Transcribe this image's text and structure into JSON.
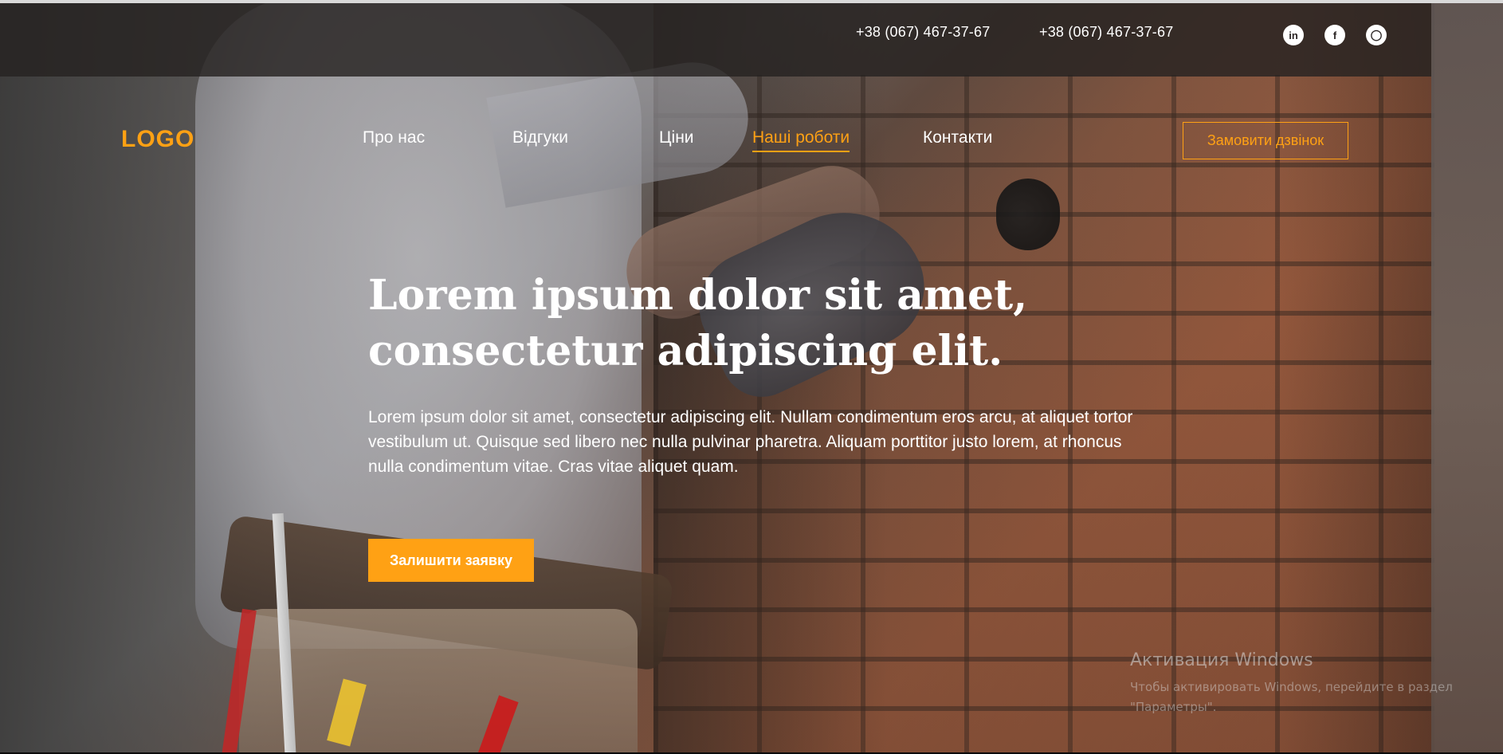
{
  "header": {
    "phones": [
      "+38 (067) 467-37-67",
      "+38 (067) 467-37-67"
    ],
    "social_icons": [
      {
        "name": "linkedin-icon",
        "glyph": "in"
      },
      {
        "name": "facebook-icon",
        "glyph": "f"
      },
      {
        "name": "instagram-icon",
        "glyph": "◯"
      }
    ]
  },
  "nav": {
    "logo": "LOGO",
    "items": [
      "Про нас",
      "Відгуки",
      "Ціни",
      "Наші роботи",
      "Контакти"
    ],
    "active_item": "Наші роботи",
    "call_button": "Замовити дзвінок"
  },
  "hero": {
    "title": "Lorem ipsum dolor sit amet, consectetur adipiscing elit.",
    "text": "Lorem ipsum dolor sit amet, consectetur adipiscing elit. Nullam condimentum eros arcu, at aliquet tortor vestibulum ut. Quisque sed libero nec nulla pulvinar pharetra. Aliquam porttitor justo lorem, at rhoncus nulla condimentum vitae. Cras vitae aliquet quam.",
    "cta_button": "Залишити заявку"
  },
  "watermark": {
    "title": "Активация Windows",
    "subtitle": "Чтобы активировать Windows, перейдите в раздел \"Параметры\"."
  },
  "colors": {
    "accent": "#ffa114",
    "top_bar": "#262221",
    "text": "#ffffff"
  }
}
